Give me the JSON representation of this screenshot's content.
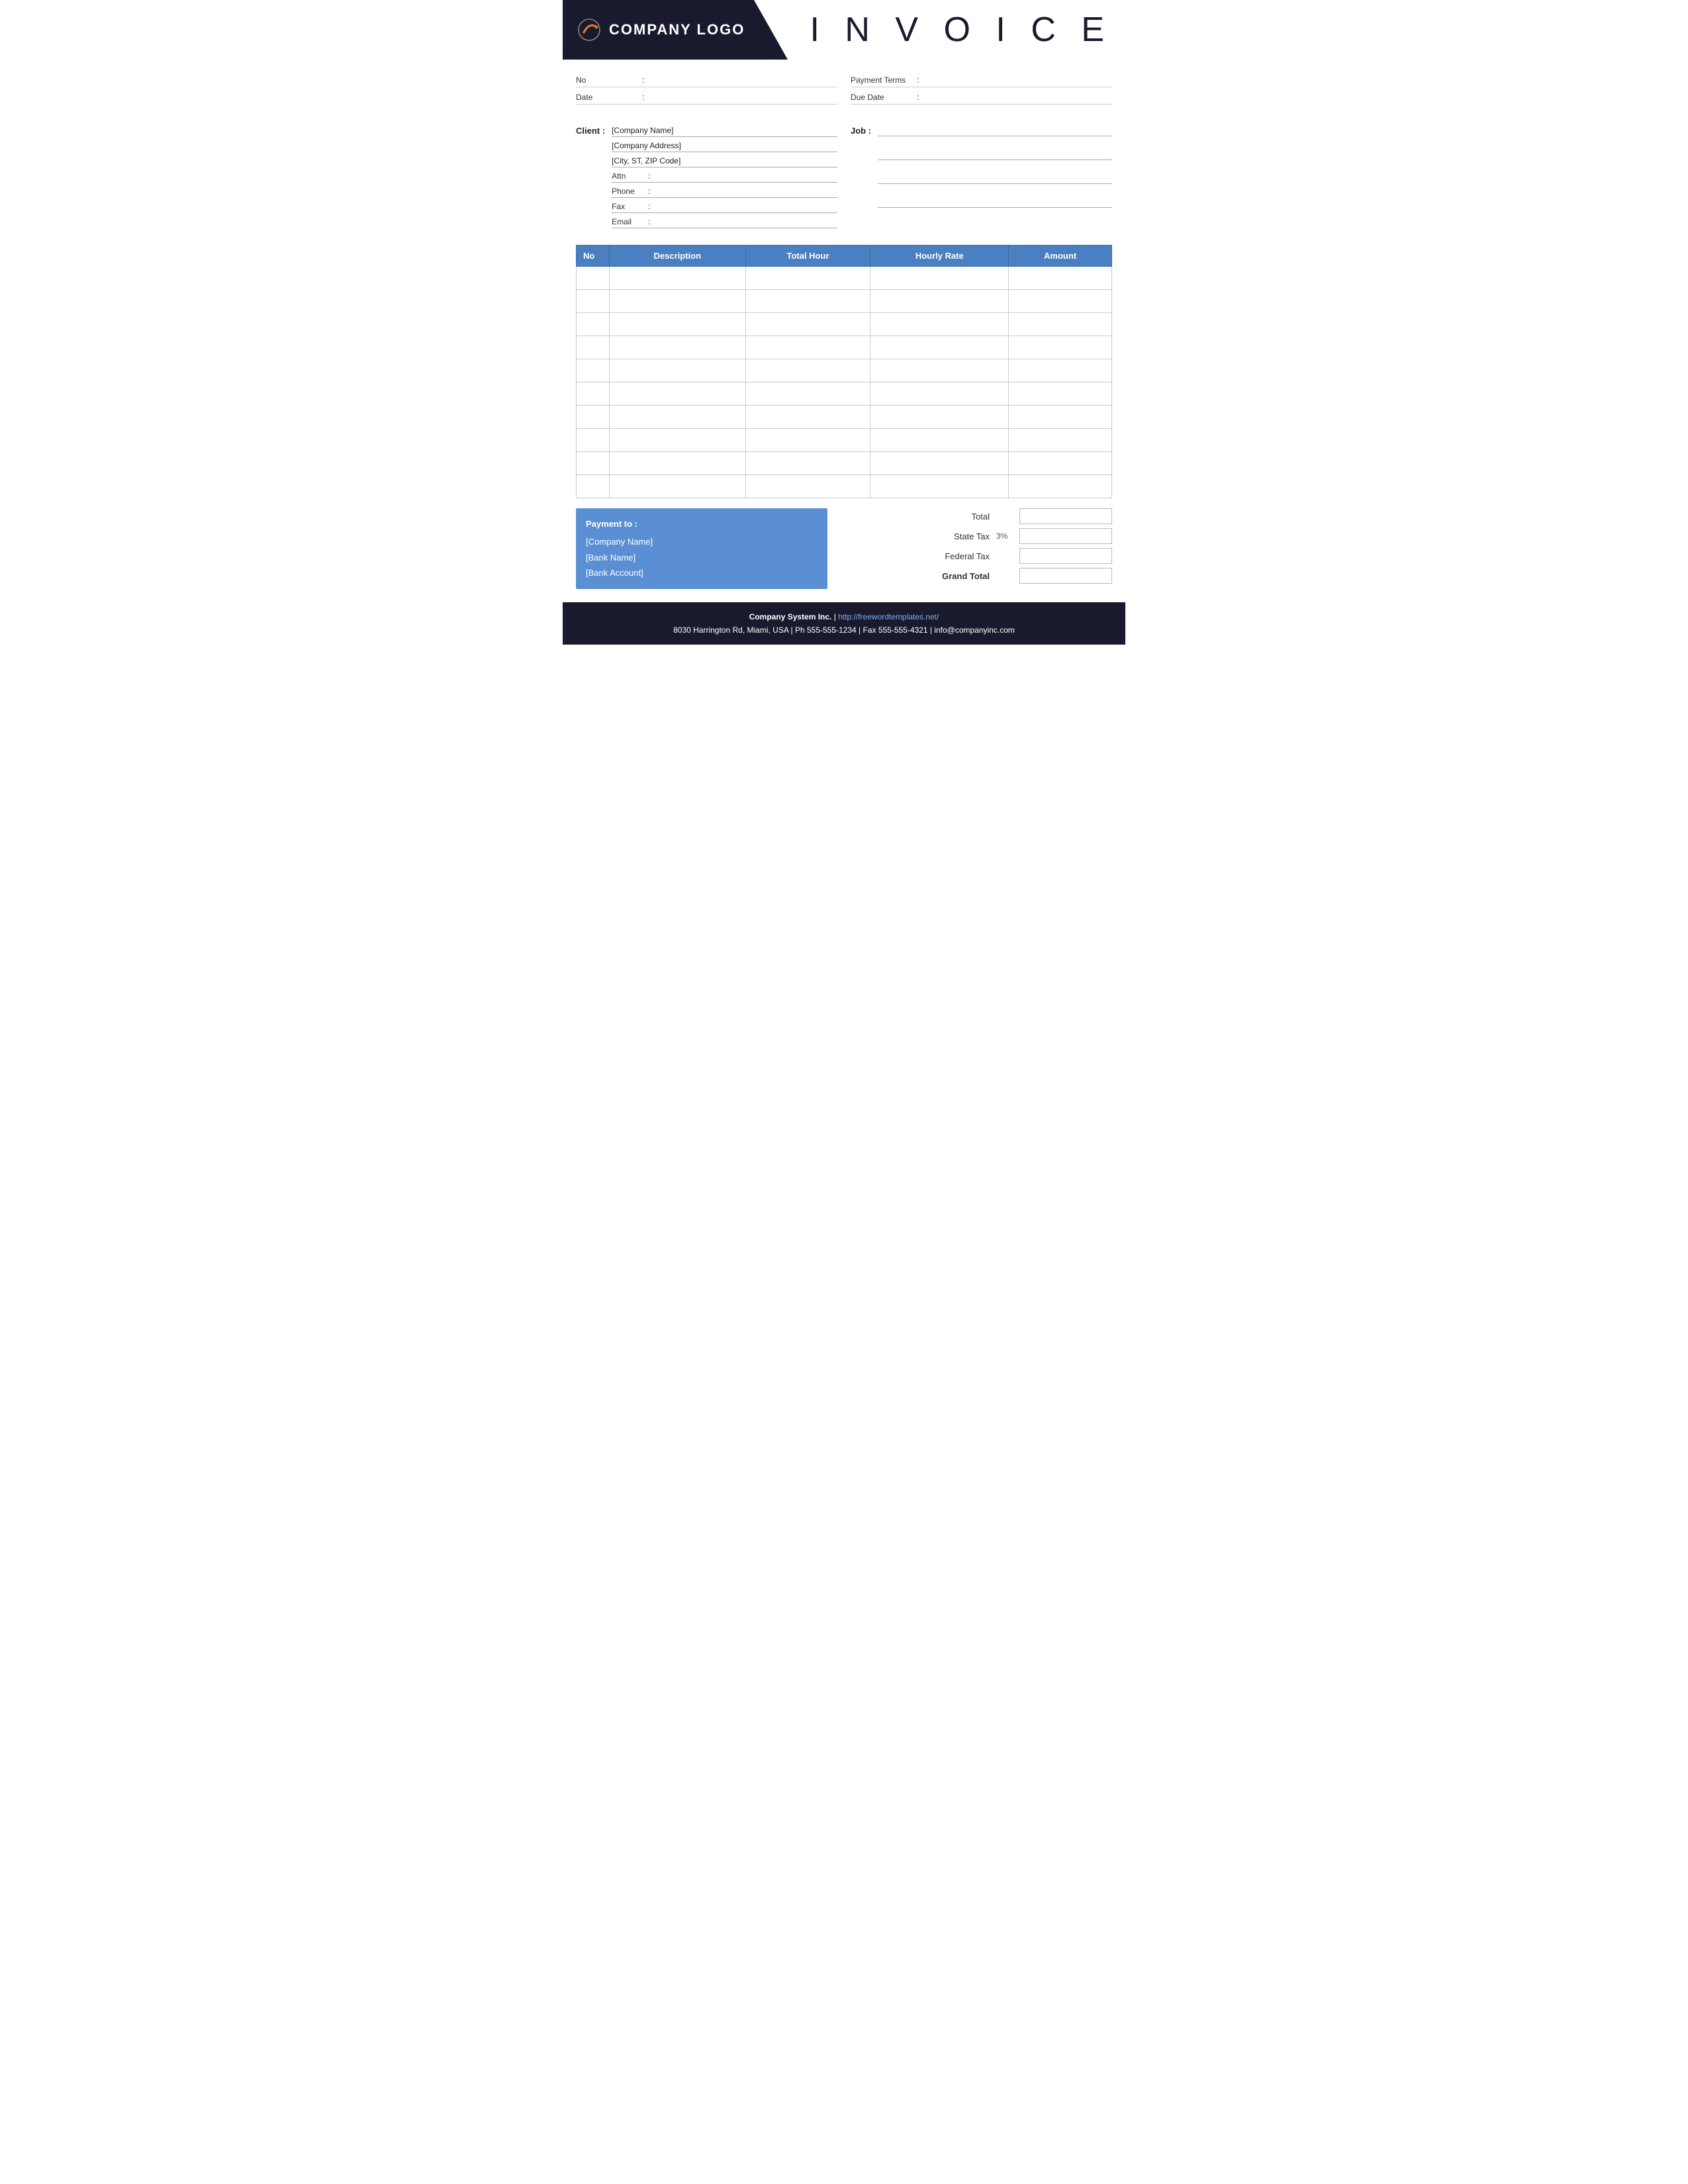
{
  "header": {
    "logo_text": "COMPANY LOGO",
    "invoice_title": "I N V O I C E"
  },
  "meta": {
    "no_label": "No",
    "no_colon": ":",
    "no_value": "",
    "payment_terms_label": "Payment  Terms",
    "payment_terms_colon": ":",
    "payment_terms_value": "",
    "date_label": "Date",
    "date_colon": ":",
    "date_value": "",
    "due_date_label": "Due Date",
    "due_date_colon": ":",
    "due_date_value": ""
  },
  "client": {
    "label": "Client :",
    "company_name": "[Company Name]",
    "company_address": "[Company Address]",
    "city_zip": "[City, ST, ZIP Code]",
    "attn_label": "Attn",
    "attn_colon": ":",
    "attn_value": "",
    "phone_label": "Phone",
    "phone_colon": ":",
    "phone_value": "",
    "fax_label": "Fax",
    "fax_colon": ":",
    "fax_value": "",
    "email_label": "Email",
    "email_colon": ":",
    "email_value": ""
  },
  "job": {
    "label": "Job :",
    "lines": [
      "",
      "",
      "",
      ""
    ]
  },
  "table": {
    "headers": [
      "No",
      "Description",
      "Total Hour",
      "Hourly Rate",
      "Amount"
    ],
    "rows": [
      {
        "no": "",
        "description": "",
        "total_hour": "",
        "hourly_rate": "",
        "amount": ""
      },
      {
        "no": "",
        "description": "",
        "total_hour": "",
        "hourly_rate": "",
        "amount": ""
      },
      {
        "no": "",
        "description": "",
        "total_hour": "",
        "hourly_rate": "",
        "amount": ""
      },
      {
        "no": "",
        "description": "",
        "total_hour": "",
        "hourly_rate": "",
        "amount": ""
      },
      {
        "no": "",
        "description": "",
        "total_hour": "",
        "hourly_rate": "",
        "amount": ""
      },
      {
        "no": "",
        "description": "",
        "total_hour": "",
        "hourly_rate": "",
        "amount": ""
      },
      {
        "no": "",
        "description": "",
        "total_hour": "",
        "hourly_rate": "",
        "amount": ""
      },
      {
        "no": "",
        "description": "",
        "total_hour": "",
        "hourly_rate": "",
        "amount": ""
      },
      {
        "no": "",
        "description": "",
        "total_hour": "",
        "hourly_rate": "",
        "amount": ""
      },
      {
        "no": "",
        "description": "",
        "total_hour": "",
        "hourly_rate": "",
        "amount": ""
      }
    ]
  },
  "payment": {
    "title": "Payment to :",
    "company_name": "[Company Name]",
    "bank_name": "[Bank Name]",
    "bank_account": "[Bank Account]"
  },
  "totals": {
    "total_label": "Total",
    "state_tax_label": "State Tax",
    "state_tax_percent": "3%",
    "federal_tax_label": "Federal Tax",
    "grand_total_label": "Grand Total"
  },
  "footer": {
    "company": "Company System Inc.",
    "separator": " | ",
    "website": "http://freewordtemplates.net/",
    "address": "8030 Harrington Rd, Miami, USA | Ph 555-555-1234 | Fax 555-555-4321 | info@companyinc.com"
  }
}
